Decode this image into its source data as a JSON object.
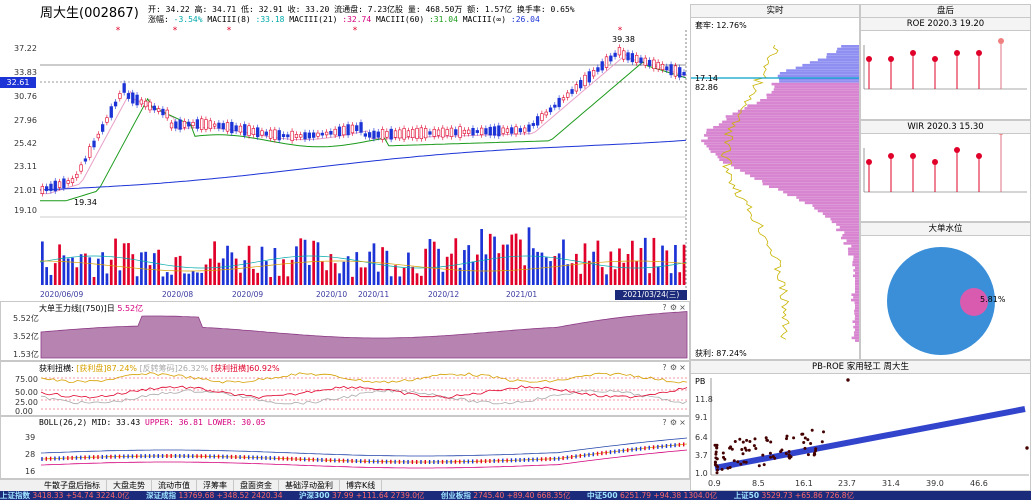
{
  "stock": {
    "name_code": "周大生(002867)",
    "ohlc_line": "开: 34.22 高: 34.71 低: 32.91 收: 33.20 流通盘: 7.23亿股 量: 468.50万 额: 1.57亿 换手率: 0.65%",
    "change_label": "涨幅: ",
    "change_value": "-3.54%",
    "ma8_label": " MACIII(8) ",
    "ma8_value": ":33.18",
    "ma21_label": " MACIII(21) ",
    "ma21_value": ":32.74",
    "ma60_label": " MACIII(60) ",
    "ma60_value": ":31.04",
    "mainf_label": " MACIII(∞) ",
    "mainf_value": ":26.04"
  },
  "price_chart": {
    "y_labels": [
      "37.22",
      "33.83",
      "30.76",
      "27.96",
      "25.42",
      "23.11",
      "21.01",
      "19.10"
    ],
    "current_price": "32.61",
    "high_label": "39.38",
    "low_label": "19.34",
    "x_labels": [
      "2020/06/09",
      "2020/08",
      "2020/09",
      "2020/10",
      "2020/11",
      "2020/12",
      "2021/01"
    ],
    "date_badge": "2021/03/24(三)"
  },
  "chip_panel": {
    "title": "实时",
    "profit_ratio": "套牢: 12.76%",
    "price_1714": "17.14",
    "price_8286": "82.86",
    "bottom_label": "获利: 87.24%"
  },
  "after_panel": {
    "title": "盘后"
  },
  "roe_panel": {
    "title": "ROE 2020.3 19.20",
    "lollipops": [
      0.1,
      0.1,
      0.12,
      0.1,
      0.12,
      0.12,
      0.16
    ]
  },
  "wir_panel": {
    "title": "WIR 2020.3 15.30",
    "lollipops": [
      0.1,
      0.12,
      0.12,
      0.1,
      0.14,
      0.12,
      0.2
    ]
  },
  "big_order": {
    "title": "大单水位",
    "pie_label": "5.81%",
    "pie_value": 5.81
  },
  "pb_panel": {
    "title": "PB-ROE 家用轻工 周大生",
    "y_axis_title": "PB",
    "y_labels": [
      "11.8",
      "9.1",
      "6.4",
      "3.7",
      "1.0"
    ],
    "x_labels": [
      "0.9",
      "8.5",
      "16.1",
      "23.7",
      "31.4",
      "39.0",
      "46.6"
    ]
  },
  "big_king": {
    "title": "大单王力线[(750)]日",
    "value": "5.52亿",
    "y_labels": [
      "5.52亿",
      "3.52亿",
      "1.53亿"
    ]
  },
  "profit_panel": {
    "title": "获利扭横:",
    "a_label": "[获利盘]",
    "a_value": "87.24%",
    "b_label": "[反转筹码]",
    "b_value": "26.32%",
    "c_label": "[获利扭横]",
    "c_value": "60.92%",
    "y_labels": [
      "75.00",
      "50.00",
      "25.00",
      "0.00"
    ]
  },
  "boll_panel": {
    "title": "BOLL(26,2)",
    "mid_label": "MID: ",
    "mid_value": "33.43",
    "upper_label": "UPPER: ",
    "upper_value": "36.81",
    "lower_label": "LOWER: ",
    "lower_value": "30.05",
    "y_labels": [
      "39",
      "28",
      "16"
    ]
  },
  "tabs": [
    "牛散子盘后指标",
    "大盘走势",
    "流动市值",
    "浮筹率",
    "盘面资金",
    "基础浮动盈利",
    "博弈K线"
  ],
  "status_bar": [
    {
      "label": "上证指数",
      "text": "3418.33 +54.74 3224.0亿"
    },
    {
      "label": "深证成指",
      "text": "13769.68 +348.52 2420.34"
    },
    {
      "label": "沪深300",
      "text": "37.99 +111.64 2739.0亿"
    },
    {
      "label": "创业板指",
      "text": "2745.40 +89.40 668.35亿"
    },
    {
      "label": "中证500",
      "text": "6251.79 +94.38 1304.0亿"
    },
    {
      "label": "上证50",
      "text": "3529.73 +65.86 726.8亿"
    }
  ],
  "colors": {
    "up": "#e0002a",
    "down": "#1c33d6",
    "ma8": "#e8a0c8",
    "ma21": "#1a9a1a",
    "ma60": "#1c33d6",
    "accent": "#1b2a7a"
  }
}
